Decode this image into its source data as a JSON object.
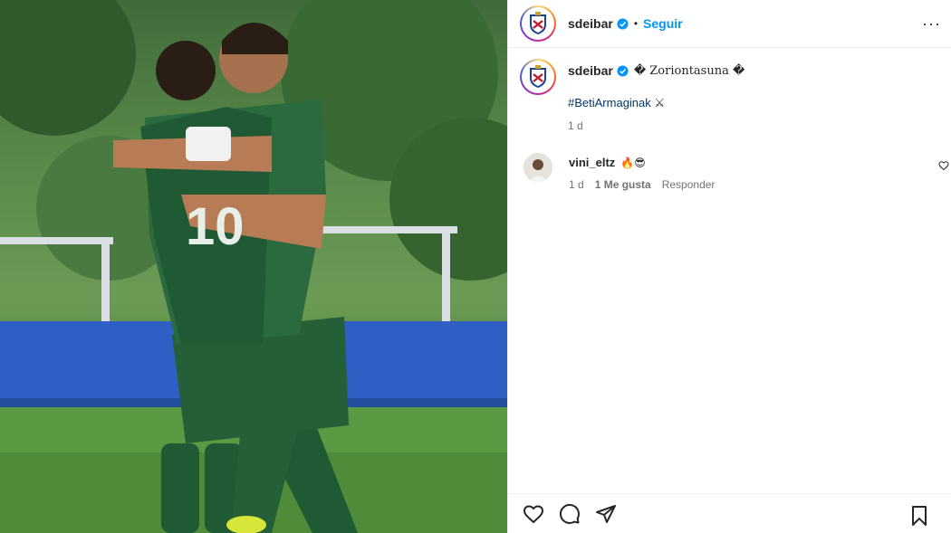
{
  "post": {
    "author": "sdeibar",
    "separator": "•",
    "follow_label": "Seguir",
    "more_label": "···",
    "caption_message": "� Zoriontasuna �",
    "hashtag": "#BetiArmaginak",
    "hashtag_emoji": "⚔",
    "time_ago": "1 d"
  },
  "comment": {
    "author": "vini_eltz",
    "text": "🔥😎",
    "time_ago": "1 d",
    "likes_label": "1 Me gusta",
    "reply_label": "Responder"
  },
  "photo": {
    "jersey_number": "10"
  },
  "colors": {
    "accent_blue": "#0095f6",
    "hashtag_blue": "#00376b",
    "muted": "#737373",
    "jersey_green": "#1f5a34"
  },
  "icons": {
    "like": "heart-icon",
    "comment": "comment-icon",
    "share": "share-icon",
    "save": "bookmark-icon",
    "verified": "verified-badge-icon",
    "more": "more-options-icon"
  }
}
